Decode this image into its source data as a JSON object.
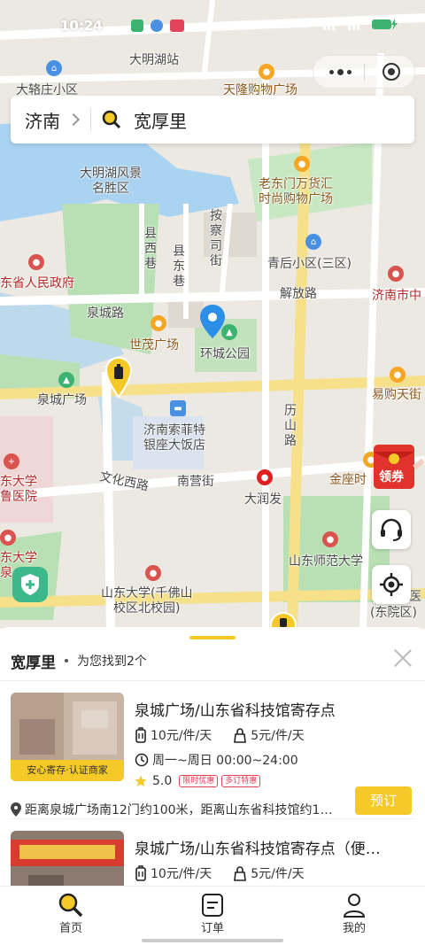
{
  "status_bar": {
    "time": "10:24"
  },
  "search": {
    "city": "济南",
    "query": "宽厚里"
  },
  "map": {
    "labels": {
      "station": "大明湖站",
      "dakuizhuang": "大辂庄小区",
      "tianlong": "天隆购物广场",
      "daming_park": "大明湖风景\n名胜区",
      "laodongmen": "老东门万货汇\n时尚购物广场",
      "anchasi": "按\n察\n司\n街",
      "xianxi": "县\n西\n巷",
      "xiandong": "县\n东\n巷",
      "qinghou": "青后小区(三区)",
      "gov": "东省人民政府",
      "jiefang": "解放路",
      "jinan_city": "济南市中",
      "quancheng_rd": "泉城路",
      "shimao": "世茂广场",
      "huancheng": "环城公园",
      "quancheng_sq": "泉城广场",
      "yigou": "易购天街",
      "lishan": "历\n山\n路",
      "sofitel": "济南索菲特\n银座大饭店",
      "wenhua": "文化西路",
      "nanying": "南营街",
      "jinzuo": "金座时",
      "dadun": "大润发",
      "hospital": "东大学\n鲁医院",
      "shida": "山东师范大学",
      "sdu": "山东大学(千佛山\n校区北校园)",
      "dongyuan": "(东院区)",
      "hospital2": "医",
      "shandong_u2": "东大学\n泉"
    },
    "red_packet_label": "领券"
  },
  "sheet": {
    "title": "宽厚里",
    "subtitle": "为您找到2个",
    "results": [
      {
        "title": "泉城广场/山东省科技馆寄存点",
        "price_luggage": "10元/件/天",
        "price_bag": "5元/件/天",
        "hours": "周一~周日 00:00~24:00",
        "rating": "5.0",
        "badges": [
          "限时优惠",
          "多订特惠"
        ],
        "tag": "安心寄存·认证商家",
        "address": "距离泉城广场南12门约100米，距离山东省科技馆约1…",
        "book_label": "预订"
      },
      {
        "title": "泉城广场/山东省科技馆寄存点（便…",
        "price_luggage": "10元/件/天",
        "price_bag": "5元/件/天"
      }
    ]
  },
  "tabs": [
    {
      "label": "首页",
      "icon": "search-icon"
    },
    {
      "label": "订单",
      "icon": "order-icon"
    },
    {
      "label": "我的",
      "icon": "profile-icon"
    }
  ],
  "colors": {
    "accent": "#f4c928",
    "park": "#b8e0b4",
    "water": "#aad3f2",
    "road": "#ffffff",
    "main_road": "#f6e08a"
  }
}
